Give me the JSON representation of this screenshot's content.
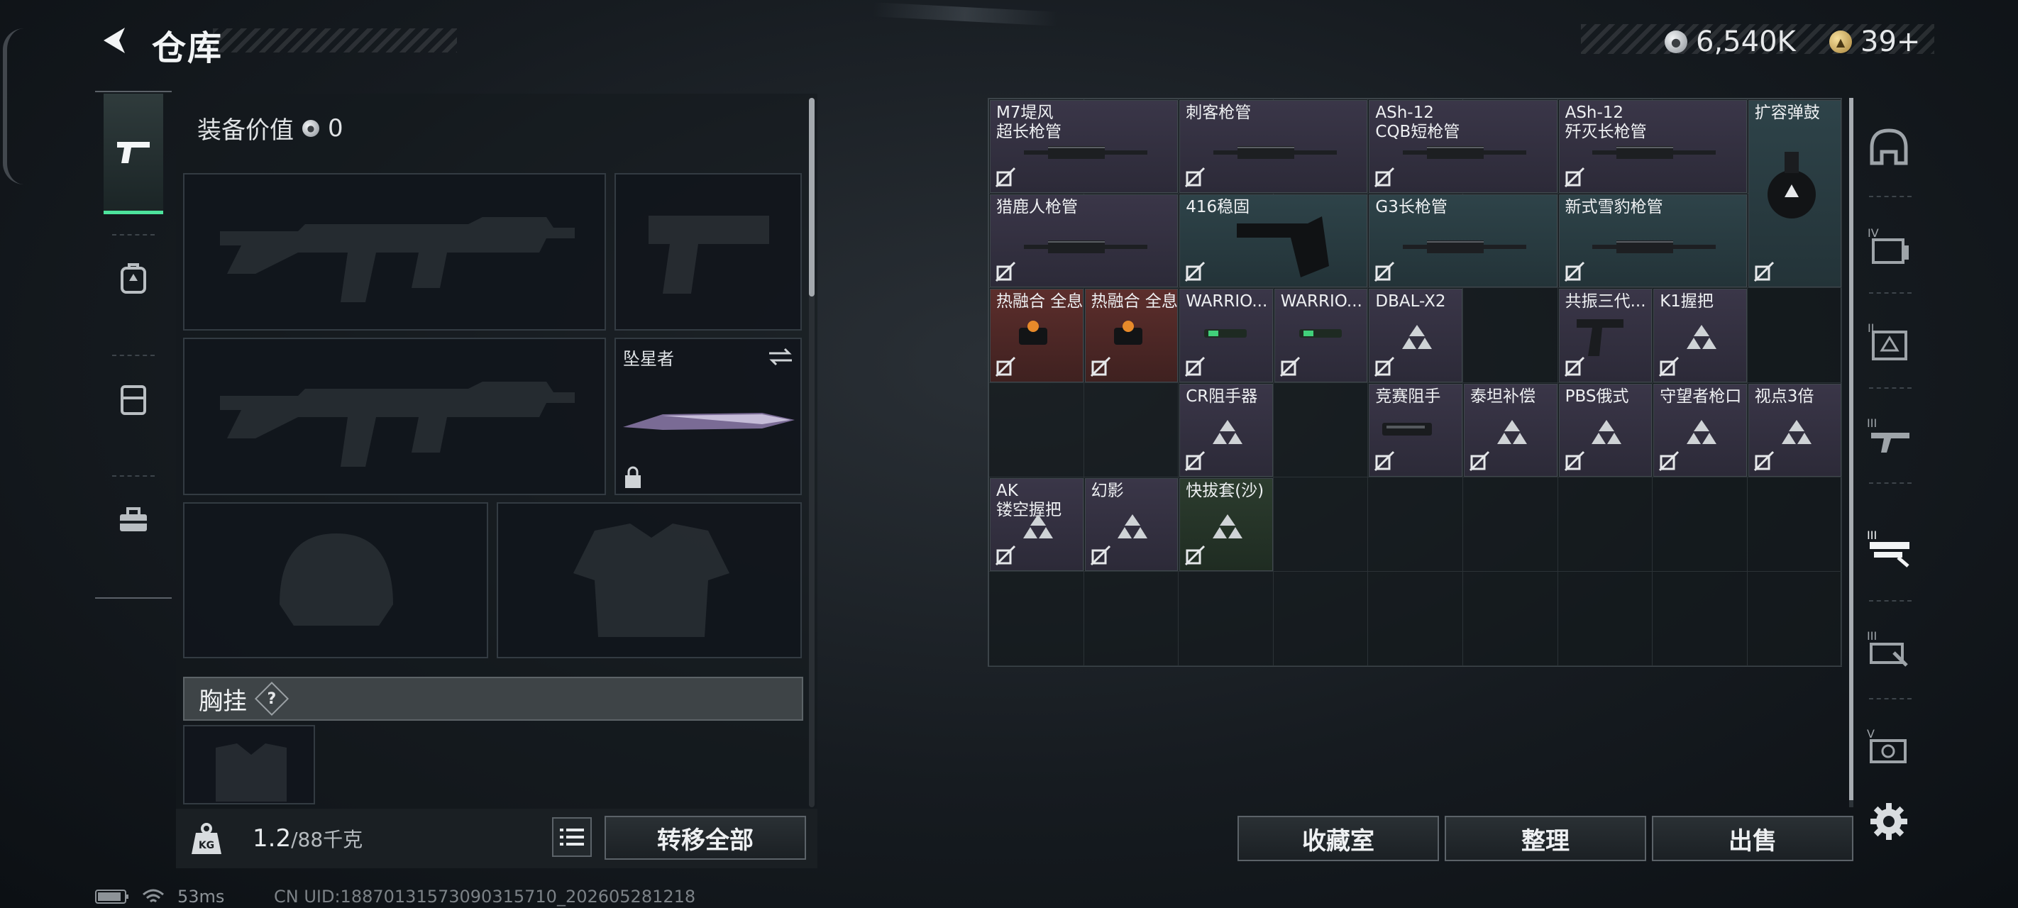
{
  "header": {
    "title": "仓库",
    "silver_amount": "6,540K",
    "gold_amount": "39+"
  },
  "left_tabs": [
    {
      "name": "pistol-icon",
      "active": true
    },
    {
      "name": "backpack-icon",
      "active": false
    },
    {
      "name": "vest-icon",
      "active": false
    },
    {
      "name": "toolbox-icon",
      "active": false
    }
  ],
  "equipment": {
    "value_label": "装备价值",
    "value": "0",
    "melee_name": "坠星者",
    "chest_label": "胸挂",
    "chest_help": "?"
  },
  "bottom_left": {
    "weight_current": "1.2",
    "weight_max": "/88千克",
    "transfer_all": "转移全部"
  },
  "status": {
    "ping": "53ms",
    "uid": "CN UID:188701315730903157‍10_202605281218"
  },
  "inventory": {
    "items": [
      {
        "name": "M7堤风\n超长枪管",
        "rarity": "purple"
      },
      {
        "name": "刺客枪管",
        "rarity": "purple"
      },
      {
        "name": "ASh-12\nCQB短枪管",
        "rarity": "purple"
      },
      {
        "name": "ASh-12\n歼灭长枪管",
        "rarity": "purple"
      },
      {
        "name": "扩容弹鼓",
        "rarity": "blue"
      },
      {
        "name": "猎鹿人枪管",
        "rarity": "purple"
      },
      {
        "name": "416稳固",
        "rarity": "blue"
      },
      {
        "name": "G3长枪管",
        "rarity": "blue"
      },
      {
        "name": "新式雪豹枪管",
        "rarity": "blue"
      },
      {
        "name": "热融合 全息",
        "rarity": "red"
      },
      {
        "name": "热融合 全息",
        "rarity": "red"
      },
      {
        "name": "WARRIO...",
        "rarity": "purple"
      },
      {
        "name": "WARRIO...",
        "rarity": "purple"
      },
      {
        "name": "DBAL-X2",
        "rarity": "purple"
      },
      {
        "name": "共振三代...",
        "rarity": "purple"
      },
      {
        "name": "K1握把",
        "rarity": "purple"
      },
      {
        "name": "CR阻手器",
        "rarity": "purple"
      },
      {
        "name": "竞赛阻手",
        "rarity": "purple"
      },
      {
        "name": "泰坦补偿",
        "rarity": "purple"
      },
      {
        "name": "PBS俄式",
        "rarity": "purple"
      },
      {
        "name": "守望者枪口",
        "rarity": "purple"
      },
      {
        "name": "视点3倍",
        "rarity": "purple"
      },
      {
        "name": "AK\n镂空握把",
        "rarity": "purple"
      },
      {
        "name": "幻影",
        "rarity": "purple"
      },
      {
        "name": "快拔套(沙)",
        "rarity": "green"
      }
    ]
  },
  "actions": {
    "collection": "收藏室",
    "organize": "整理",
    "sell": "出售"
  },
  "right_tabs": [
    {
      "name": "helmet-icon",
      "tier": ""
    },
    {
      "name": "tier4-container-icon",
      "tier": "IV"
    },
    {
      "name": "tier2-container-icon",
      "tier": "II"
    },
    {
      "name": "tier3-gun-icon",
      "tier": "III"
    },
    {
      "name": "tier3-attachment-icon",
      "tier": "III"
    },
    {
      "name": "tier3-tool-icon",
      "tier": "III"
    },
    {
      "name": "tier5-gun-icon",
      "tier": "V"
    }
  ]
}
